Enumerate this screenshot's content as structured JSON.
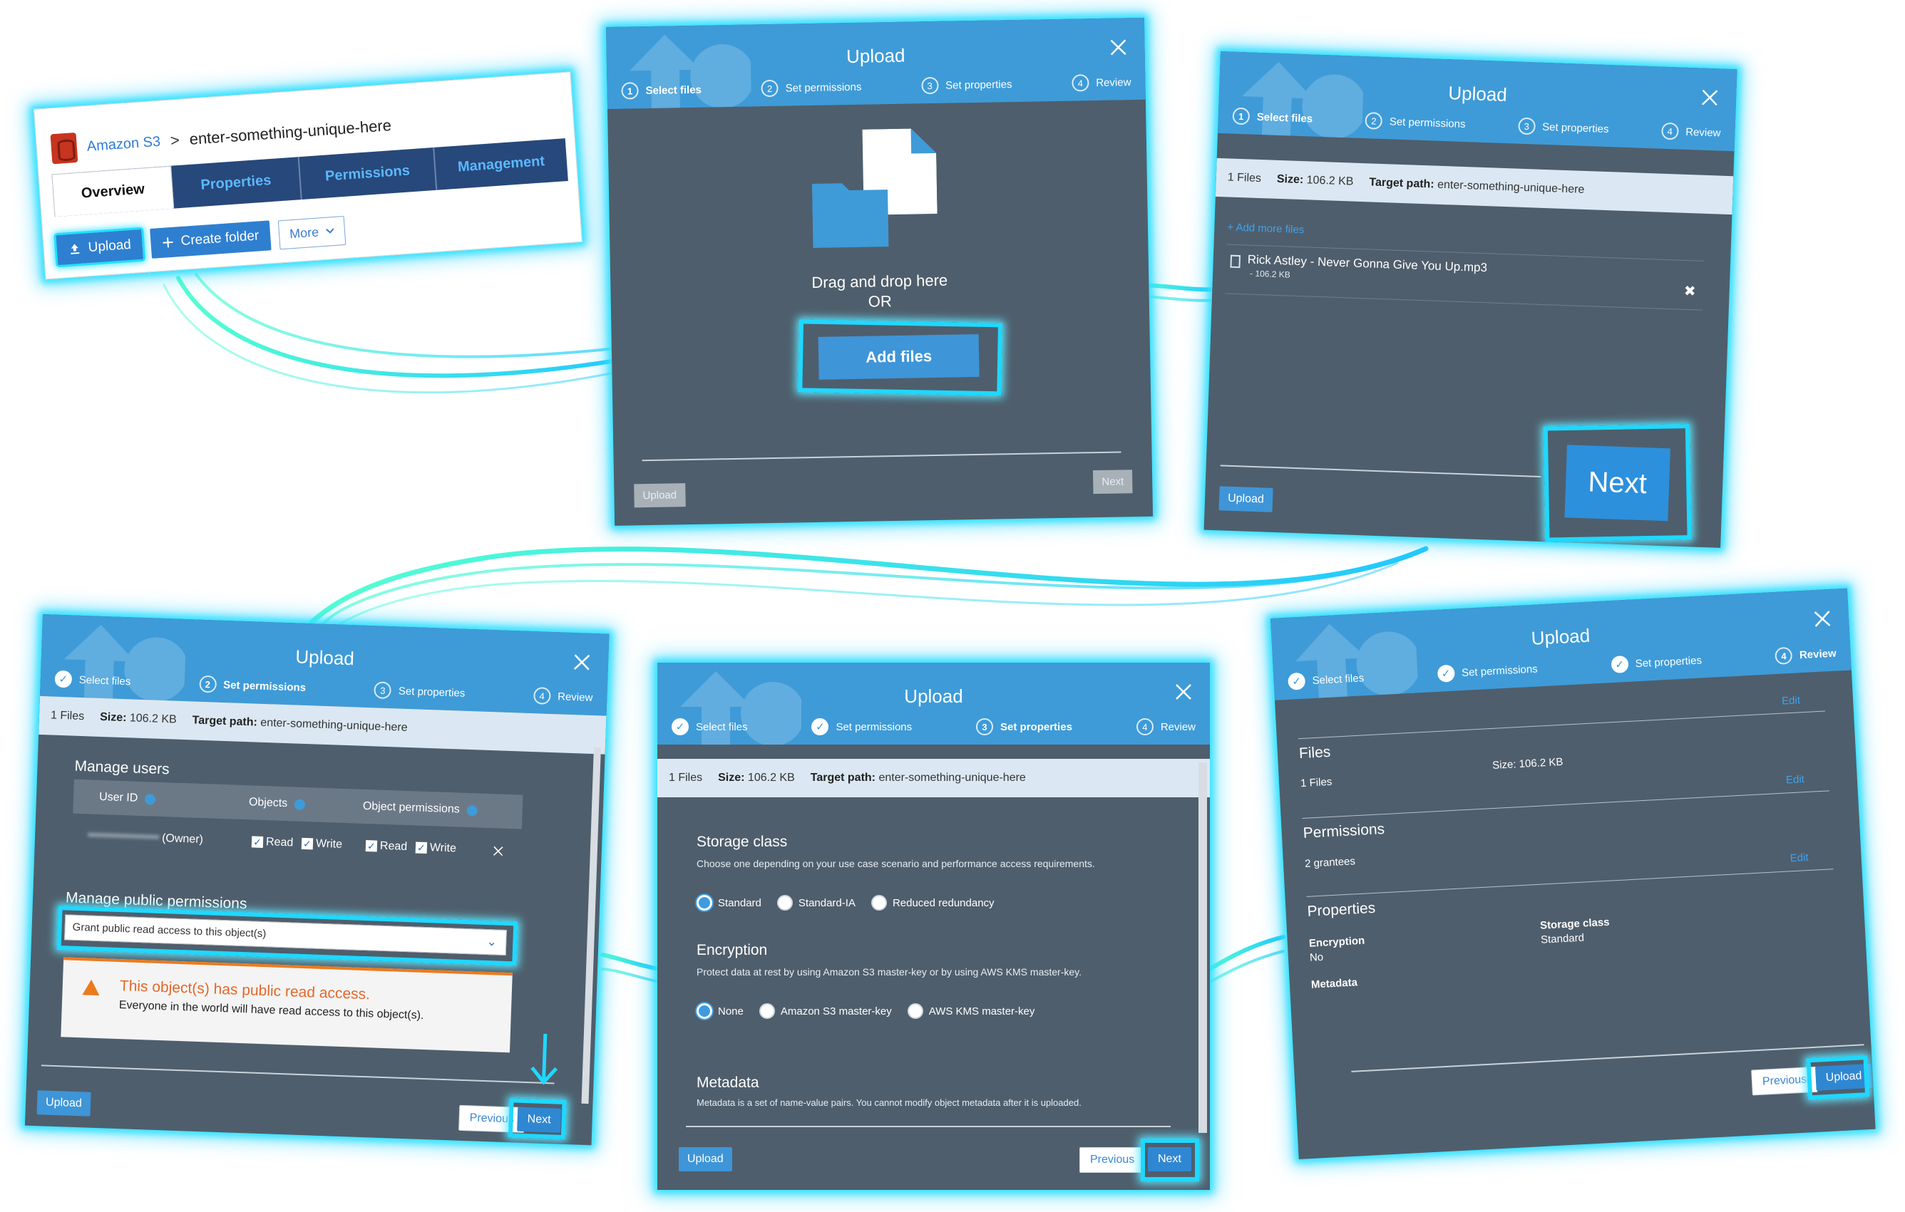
{
  "colors": {
    "modal_header": "#3e9bd8",
    "modal_body": "#4f5e6c",
    "highlight": "#1fd8ff",
    "warning": "#ec7a1a"
  },
  "bucket_panel": {
    "breadcrumb_link": "Amazon S3",
    "breadcrumb_sep": ">",
    "bucket_name": "enter-something-unique-here",
    "tabs": [
      "Overview",
      "Properties",
      "Permissions",
      "Management"
    ],
    "upload_label": "Upload",
    "create_folder_label": "Create folder",
    "more_label": "More"
  },
  "wizard": {
    "title": "Upload",
    "steps": [
      "Select files",
      "Set permissions",
      "Set properties",
      "Review"
    ],
    "upload_btn": "Upload",
    "next_btn": "Next",
    "previous_btn": "Previous"
  },
  "select_panel": {
    "drag_text": "Drag and drop here",
    "or_text": "OR",
    "add_files": "Add files"
  },
  "file_info": {
    "files_count": "1 Files",
    "size_label": "Size:",
    "size_value": "106.2 KB",
    "target_label": "Target path:",
    "target_value": "enter-something-unique-here"
  },
  "files_panel": {
    "add_more": "Add more files",
    "file_name": "Rick Astley - Never Gonna Give You Up.mp3",
    "file_size": "- 106.2 KB",
    "remove_glyph": "✖"
  },
  "permissions_panel": {
    "manage_users": "Manage users",
    "col_user_id": "User ID",
    "col_objects": "Objects",
    "col_object_permissions": "Object permissions",
    "owner_label": "(Owner)",
    "read": "Read",
    "write": "Write",
    "manage_public": "Manage public permissions",
    "public_select": "Grant public read access to this object(s)",
    "warn_title": "This object(s) has public read access.",
    "warn_text": "Everyone in the world will have read access to this object(s)."
  },
  "properties_panel": {
    "storage_title": "Storage class",
    "storage_desc": "Choose one depending on your use case scenario and performance access requirements.",
    "storage_options": [
      "Standard",
      "Standard-IA",
      "Reduced redundancy"
    ],
    "storage_selected": "Standard",
    "encryption_title": "Encryption",
    "encryption_desc": "Protect data at rest by using Amazon S3 master-key or by using AWS KMS master-key.",
    "encryption_options": [
      "None",
      "Amazon S3 master-key",
      "AWS KMS master-key"
    ],
    "encryption_selected": "None",
    "metadata_title": "Metadata",
    "metadata_desc": "Metadata is a set of name-value pairs. You cannot modify object metadata after it is uploaded."
  },
  "review_panel": {
    "edit": "Edit",
    "files_title": "Files",
    "files_count": "1 Files",
    "size_text": "Size: 106.2 KB",
    "permissions_title": "Permissions",
    "grantees": "2 grantees",
    "properties_title": "Properties",
    "encryption_label": "Encryption",
    "encryption_value": "No",
    "storage_class_label": "Storage class",
    "storage_class_value": "Standard",
    "metadata_label": "Metadata"
  }
}
